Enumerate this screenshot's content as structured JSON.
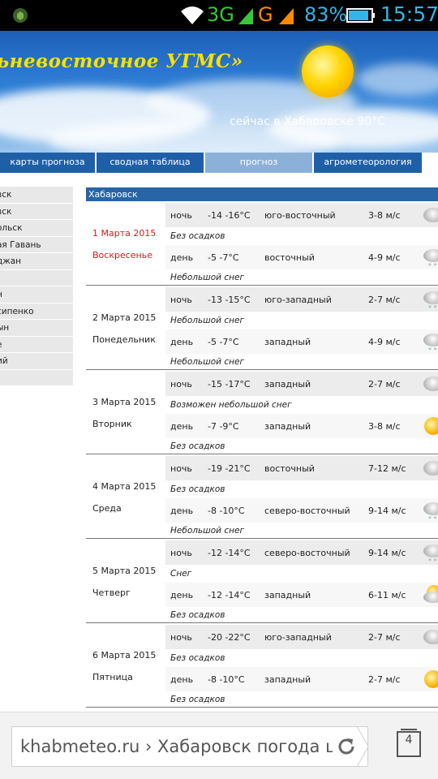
{
  "status": {
    "net1": "3G",
    "net2": "G",
    "battery_pct": "83%",
    "clock": "15:57"
  },
  "banner": {
    "title": "ьневосточное УГМС»",
    "now": "сейчас в Хабаровске 90°C"
  },
  "nav": {
    "tabs": [
      "карты прогноза",
      "сводная таблица",
      "прогноз",
      "агрометеорология"
    ],
    "active": 2
  },
  "sidebar": {
    "items": [
      "вск",
      "вск",
      "ольск",
      "ая Гавань",
      "джан",
      "",
      "н",
      "сипенко",
      "ын",
      "е",
      "ий",
      ""
    ]
  },
  "forecast": {
    "city": "Хабаровск",
    "days": [
      {
        "date": "1 Марта 2015",
        "weekday": "Воскресенье",
        "holiday": true,
        "night": {
          "time": "ночь",
          "temp": "-14 -16°С",
          "wind": "юго-восточный",
          "speed": "3-8 м/с",
          "icon": "cloud-icon",
          "precip": "Без осадков"
        },
        "day": {
          "time": "день",
          "temp": "-5 -7°С",
          "wind": "восточный",
          "speed": "4-9 м/с",
          "icon": "snow-cloud-icon",
          "precip": "Небольшой снег"
        }
      },
      {
        "date": "2 Марта 2015",
        "weekday": "Понедельник",
        "holiday": false,
        "night": {
          "time": "ночь",
          "temp": "-13 -15°С",
          "wind": "юго-западный",
          "speed": "2-7 м/с",
          "icon": "snow-cloud-icon",
          "precip": "Небольшой снег"
        },
        "day": {
          "time": "день",
          "temp": "-5 -7°С",
          "wind": "западный",
          "speed": "4-9 м/с",
          "icon": "snow-cloud-icon",
          "precip": "Небольшой снег"
        }
      },
      {
        "date": "3 Марта 2015",
        "weekday": "Вторник",
        "holiday": false,
        "night": {
          "time": "ночь",
          "temp": "-15 -17°С",
          "wind": "западный",
          "speed": "2-7 м/с",
          "icon": "cloud-icon",
          "precip": "Возможен небольшой снег"
        },
        "day": {
          "time": "день",
          "temp": "-7 -9°С",
          "wind": "западный",
          "speed": "3-8 м/с",
          "icon": "sun-icon",
          "precip": "Без осадков"
        }
      },
      {
        "date": "4 Марта 2015",
        "weekday": "Среда",
        "holiday": false,
        "night": {
          "time": "ночь",
          "temp": "-19 -21°С",
          "wind": "восточный",
          "speed": "7-12 м/с",
          "icon": "cloud-icon",
          "precip": "Без осадков"
        },
        "day": {
          "time": "день",
          "temp": "-8 -10°С",
          "wind": "северо-восточный",
          "speed": "9-14 м/с",
          "icon": "snow-cloud-icon",
          "precip": "Небольшой снег"
        }
      },
      {
        "date": "5 Марта 2015",
        "weekday": "Четверг",
        "holiday": false,
        "night": {
          "time": "ночь",
          "temp": "-12 -14°С",
          "wind": "северо-восточный",
          "speed": "9-14 м/с",
          "icon": "snow-cloud-icon",
          "precip": "Снег"
        },
        "day": {
          "time": "день",
          "temp": "-12 -14°С",
          "wind": "западный",
          "speed": "6-11 м/с",
          "icon": "sun-cloud-icon",
          "precip": "Без осадков"
        }
      },
      {
        "date": "6 Марта 2015",
        "weekday": "Пятница",
        "holiday": false,
        "night": {
          "time": "ночь",
          "temp": "-20 -22°С",
          "wind": "юго-западный",
          "speed": "2-7 м/с",
          "icon": "cloud-icon",
          "precip": "Без осадков"
        },
        "day": {
          "time": "день",
          "temp": "-8 -10°С",
          "wind": "западный",
          "speed": "2-7 м/с",
          "icon": "sun-icon",
          "precip": "Без осадков"
        }
      }
    ]
  },
  "browser": {
    "url": "khabmeteo.ru › Хабаровск погода ц",
    "tabs_count": "4"
  }
}
